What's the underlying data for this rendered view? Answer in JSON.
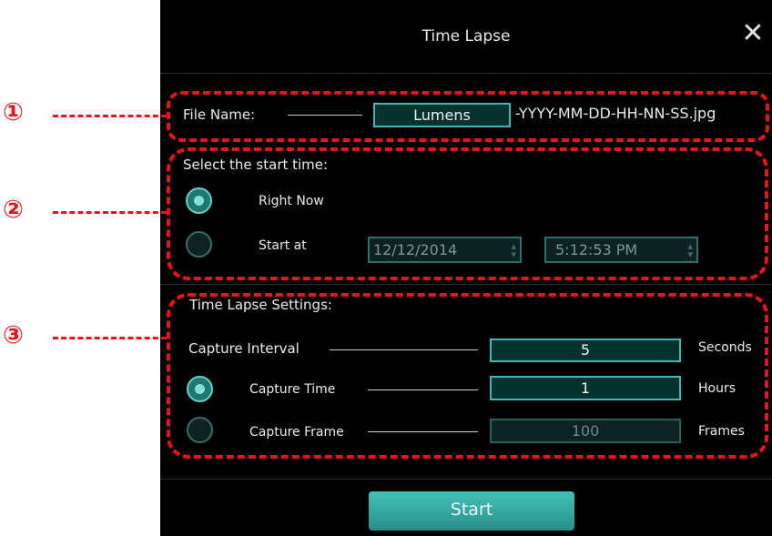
{
  "dialog": {
    "title": "Time Lapse",
    "close_icon": "close-icon",
    "file_name": {
      "label": "File Name:",
      "value": "Lumens",
      "suffix": "-YYYY-MM-DD-HH-NN-SS.jpg"
    },
    "start_time": {
      "heading": "Select the start time:",
      "right_now_label": "Right Now",
      "start_at_label": "Start at",
      "date": "12/12/2014",
      "time": "5:12:53 PM",
      "selected": "Right Now"
    },
    "settings": {
      "heading": "Time Lapse Settings:",
      "capture_interval_label": "Capture Interval",
      "capture_interval_value": "5",
      "capture_interval_unit": "Seconds",
      "capture_time_label": "Capture Time",
      "capture_time_value": "1",
      "capture_time_unit": "Hours",
      "capture_frame_label": "Capture Frame",
      "capture_frame_value": "100",
      "capture_frame_unit": "Frames",
      "selected": "Capture Time"
    },
    "start_button": "Start"
  },
  "annotations": {
    "callouts": [
      "①",
      "②",
      "③"
    ],
    "color": "#e8141b"
  },
  "colors": {
    "accent": "#3fb9b3",
    "dialog_bg": "#000000"
  }
}
